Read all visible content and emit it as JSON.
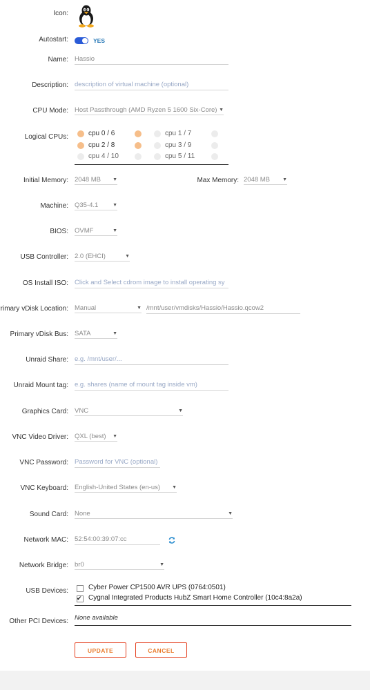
{
  "labels": {
    "icon": "Icon:",
    "autostart": "Autostart:",
    "name": "Name:",
    "description": "Description:",
    "cpu_mode": "CPU Mode:",
    "logical_cpus": "Logical CPUs:",
    "initial_memory": "Initial Memory:",
    "max_memory": "Max Memory:",
    "machine": "Machine:",
    "bios": "BIOS:",
    "usb_controller": "USB Controller:",
    "os_install_iso": "OS Install ISO:",
    "primary_vdisk_location": "Primary vDisk Location:",
    "primary_vdisk_bus": "Primary vDisk Bus:",
    "unraid_share": "Unraid Share:",
    "unraid_mount_tag": "Unraid Mount tag:",
    "graphics_card": "Graphics Card:",
    "vnc_video_driver": "VNC Video Driver:",
    "vnc_password": "VNC Password:",
    "vnc_keyboard": "VNC Keyboard:",
    "sound_card": "Sound Card:",
    "network_mac": "Network MAC:",
    "network_bridge": "Network Bridge:",
    "usb_devices": "USB Devices:",
    "other_pci_devices": "Other PCI Devices:"
  },
  "icon": {
    "name": "linux-tux-icon"
  },
  "autostart": {
    "state_label": "YES",
    "enabled": true
  },
  "fields": {
    "name": "Hassio",
    "description_placeholder": "description of virtual machine (optional)",
    "cpu_mode": "Host Passthrough (AMD Ryzen 5 1600 Six-Core)",
    "initial_memory": "2048 MB",
    "max_memory": "2048 MB",
    "machine": "Q35-4.1",
    "bios": "OVMF",
    "usb_controller": "2.0 (EHCI)",
    "os_install_iso_placeholder": "Click and Select cdrom image to install operating sy",
    "vdisk_location_mode": "Manual",
    "vdisk_path": "/mnt/user/vmdisks/Hassio/Hassio.qcow2",
    "vdisk_bus": "SATA",
    "unraid_share_placeholder": "e.g. /mnt/user/...",
    "unraid_mount_tag_placeholder": "e.g. shares (name of mount tag inside vm)",
    "graphics_card": "VNC",
    "vnc_video_driver": "QXL (best)",
    "vnc_password_placeholder": "Password for VNC (optional)",
    "vnc_keyboard": "English-United States (en-us)",
    "sound_card": "None",
    "network_mac": "52:54:00:39:07:cc",
    "network_bridge": "br0"
  },
  "cpus": [
    {
      "label": "cpu 0 / 6",
      "a": true,
      "b": true
    },
    {
      "label": "cpu 1 / 7",
      "a": false,
      "b": false
    },
    {
      "label": "cpu 2 / 8",
      "a": true,
      "b": true
    },
    {
      "label": "cpu 3 / 9",
      "a": false,
      "b": false
    },
    {
      "label": "cpu 4 / 10",
      "a": false,
      "b": false
    },
    {
      "label": "cpu 5 / 11",
      "a": false,
      "b": false
    }
  ],
  "usb_devices": [
    {
      "label": "Cyber Power CP1500 AVR UPS (0764:0501)",
      "checked": false
    },
    {
      "label": "Cygnal Integrated Products HubZ Smart Home Controller (10c4:8a2a)",
      "checked": true
    }
  ],
  "other_pci_devices": "None available",
  "buttons": {
    "update": "UPDATE",
    "cancel": "CANCEL"
  },
  "colors": {
    "accent_orange": "#e97b2c",
    "button_border": "#e43f1e",
    "toggle_blue": "#2a5bd7",
    "cpu_selected": "#f6be8a",
    "placeholder": "#98a8c6"
  }
}
